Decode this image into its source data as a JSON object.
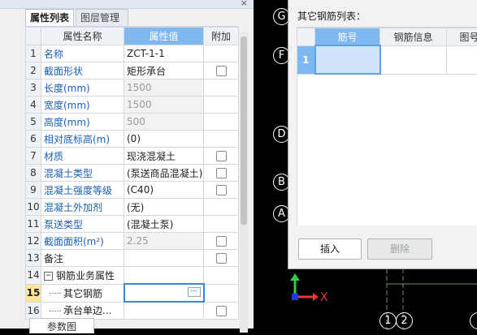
{
  "panel": {
    "close_glyph": "×",
    "tabs": [
      "属性列表",
      "图层管理"
    ],
    "columns": [
      "属性名称",
      "属性值",
      "附加"
    ],
    "rows": [
      {
        "n": "1",
        "name": "名称",
        "value": "ZCT-1-1",
        "style": "link",
        "checkbox": false,
        "disabled": false
      },
      {
        "n": "2",
        "name": "截面形状",
        "value": "矩形承台",
        "style": "link",
        "checkbox": true,
        "disabled": false
      },
      {
        "n": "3",
        "name": "长度(mm)",
        "value": "1500",
        "style": "link",
        "checkbox": false,
        "disabled": true
      },
      {
        "n": "4",
        "name": "宽度(mm)",
        "value": "1500",
        "style": "link",
        "checkbox": false,
        "disabled": true
      },
      {
        "n": "5",
        "name": "高度(mm)",
        "value": "500",
        "style": "link",
        "checkbox": false,
        "disabled": true
      },
      {
        "n": "6",
        "name": "相对底标高(m)",
        "value": "(0)",
        "style": "link",
        "checkbox": false,
        "disabled": false
      },
      {
        "n": "7",
        "name": "材质",
        "value": "现浇混凝土",
        "style": "link",
        "checkbox": true,
        "disabled": false
      },
      {
        "n": "8",
        "name": "混凝土类型",
        "value": "(泵送商品混凝土)",
        "style": "link",
        "checkbox": true,
        "disabled": false
      },
      {
        "n": "9",
        "name": "混凝土强度等级",
        "value": "(C40)",
        "style": "link",
        "checkbox": true,
        "disabled": false
      },
      {
        "n": "10",
        "name": "混凝土外加剂",
        "value": "(无)",
        "style": "link",
        "checkbox": false,
        "disabled": false
      },
      {
        "n": "11",
        "name": "泵送类型",
        "value": "(混凝土泵)",
        "style": "link",
        "checkbox": false,
        "disabled": false
      },
      {
        "n": "12",
        "name": "截面面积(m²)",
        "value": "2.25",
        "style": "link",
        "checkbox": true,
        "disabled": true
      },
      {
        "n": "13",
        "name": "备注",
        "value": "",
        "style": "plain",
        "checkbox": true,
        "disabled": false
      },
      {
        "n": "14",
        "name": "钢筋业务属性",
        "value": "",
        "style": "group",
        "checkbox": false,
        "disabled": false
      },
      {
        "n": "15",
        "name": "其它钢筋",
        "value": "",
        "style": "sub-edit",
        "checkbox": false,
        "disabled": false
      },
      {
        "n": "16",
        "name": "承台单边...",
        "value": "",
        "style": "sub",
        "checkbox": true,
        "disabled": false
      }
    ],
    "param_tab": "参数图",
    "ellipsis": "⋯",
    "minus": "−"
  },
  "cad": {
    "axis_labels_left": [
      "G",
      "F",
      "D",
      "B",
      "A"
    ],
    "axis_labels_bottom": [
      "1",
      "2"
    ],
    "ucs_x": "X"
  },
  "dialog": {
    "title": "其它钢筋列表：",
    "columns": [
      "筋号",
      "钢筋信息",
      "图号"
    ],
    "row_number": "1",
    "insert_label": "插入",
    "delete_label": "删除"
  },
  "colors": {
    "header_highlight": "#7fb8f1",
    "link_text": "#1a5fb4",
    "cad_background": "#000000",
    "ucs_y": "#2ecc40",
    "ucs_x": "#e53935",
    "ucs_z": "#1e3adb"
  }
}
